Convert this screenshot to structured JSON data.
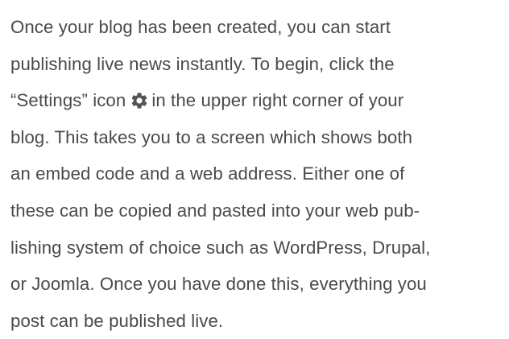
{
  "document": {
    "lines": [
      "Once your blog has been created, you can start",
      "publishing live news instantly. To begin, click the",
      {
        "before": "“Settings” icon",
        "icon": "gear-icon",
        "after": "in the upper right corner of your"
      },
      "blog. This takes you to a screen which shows both",
      "an embed code and a web address. Either one of",
      "these can be copied and pasted into your web pub-",
      "lishing system of choice such as WordPress, Drupal,",
      "or Joomla. Once you have done this, everything you",
      "post can be published live."
    ]
  },
  "colors": {
    "text": "#4a4a4a",
    "icon": "#555555"
  }
}
